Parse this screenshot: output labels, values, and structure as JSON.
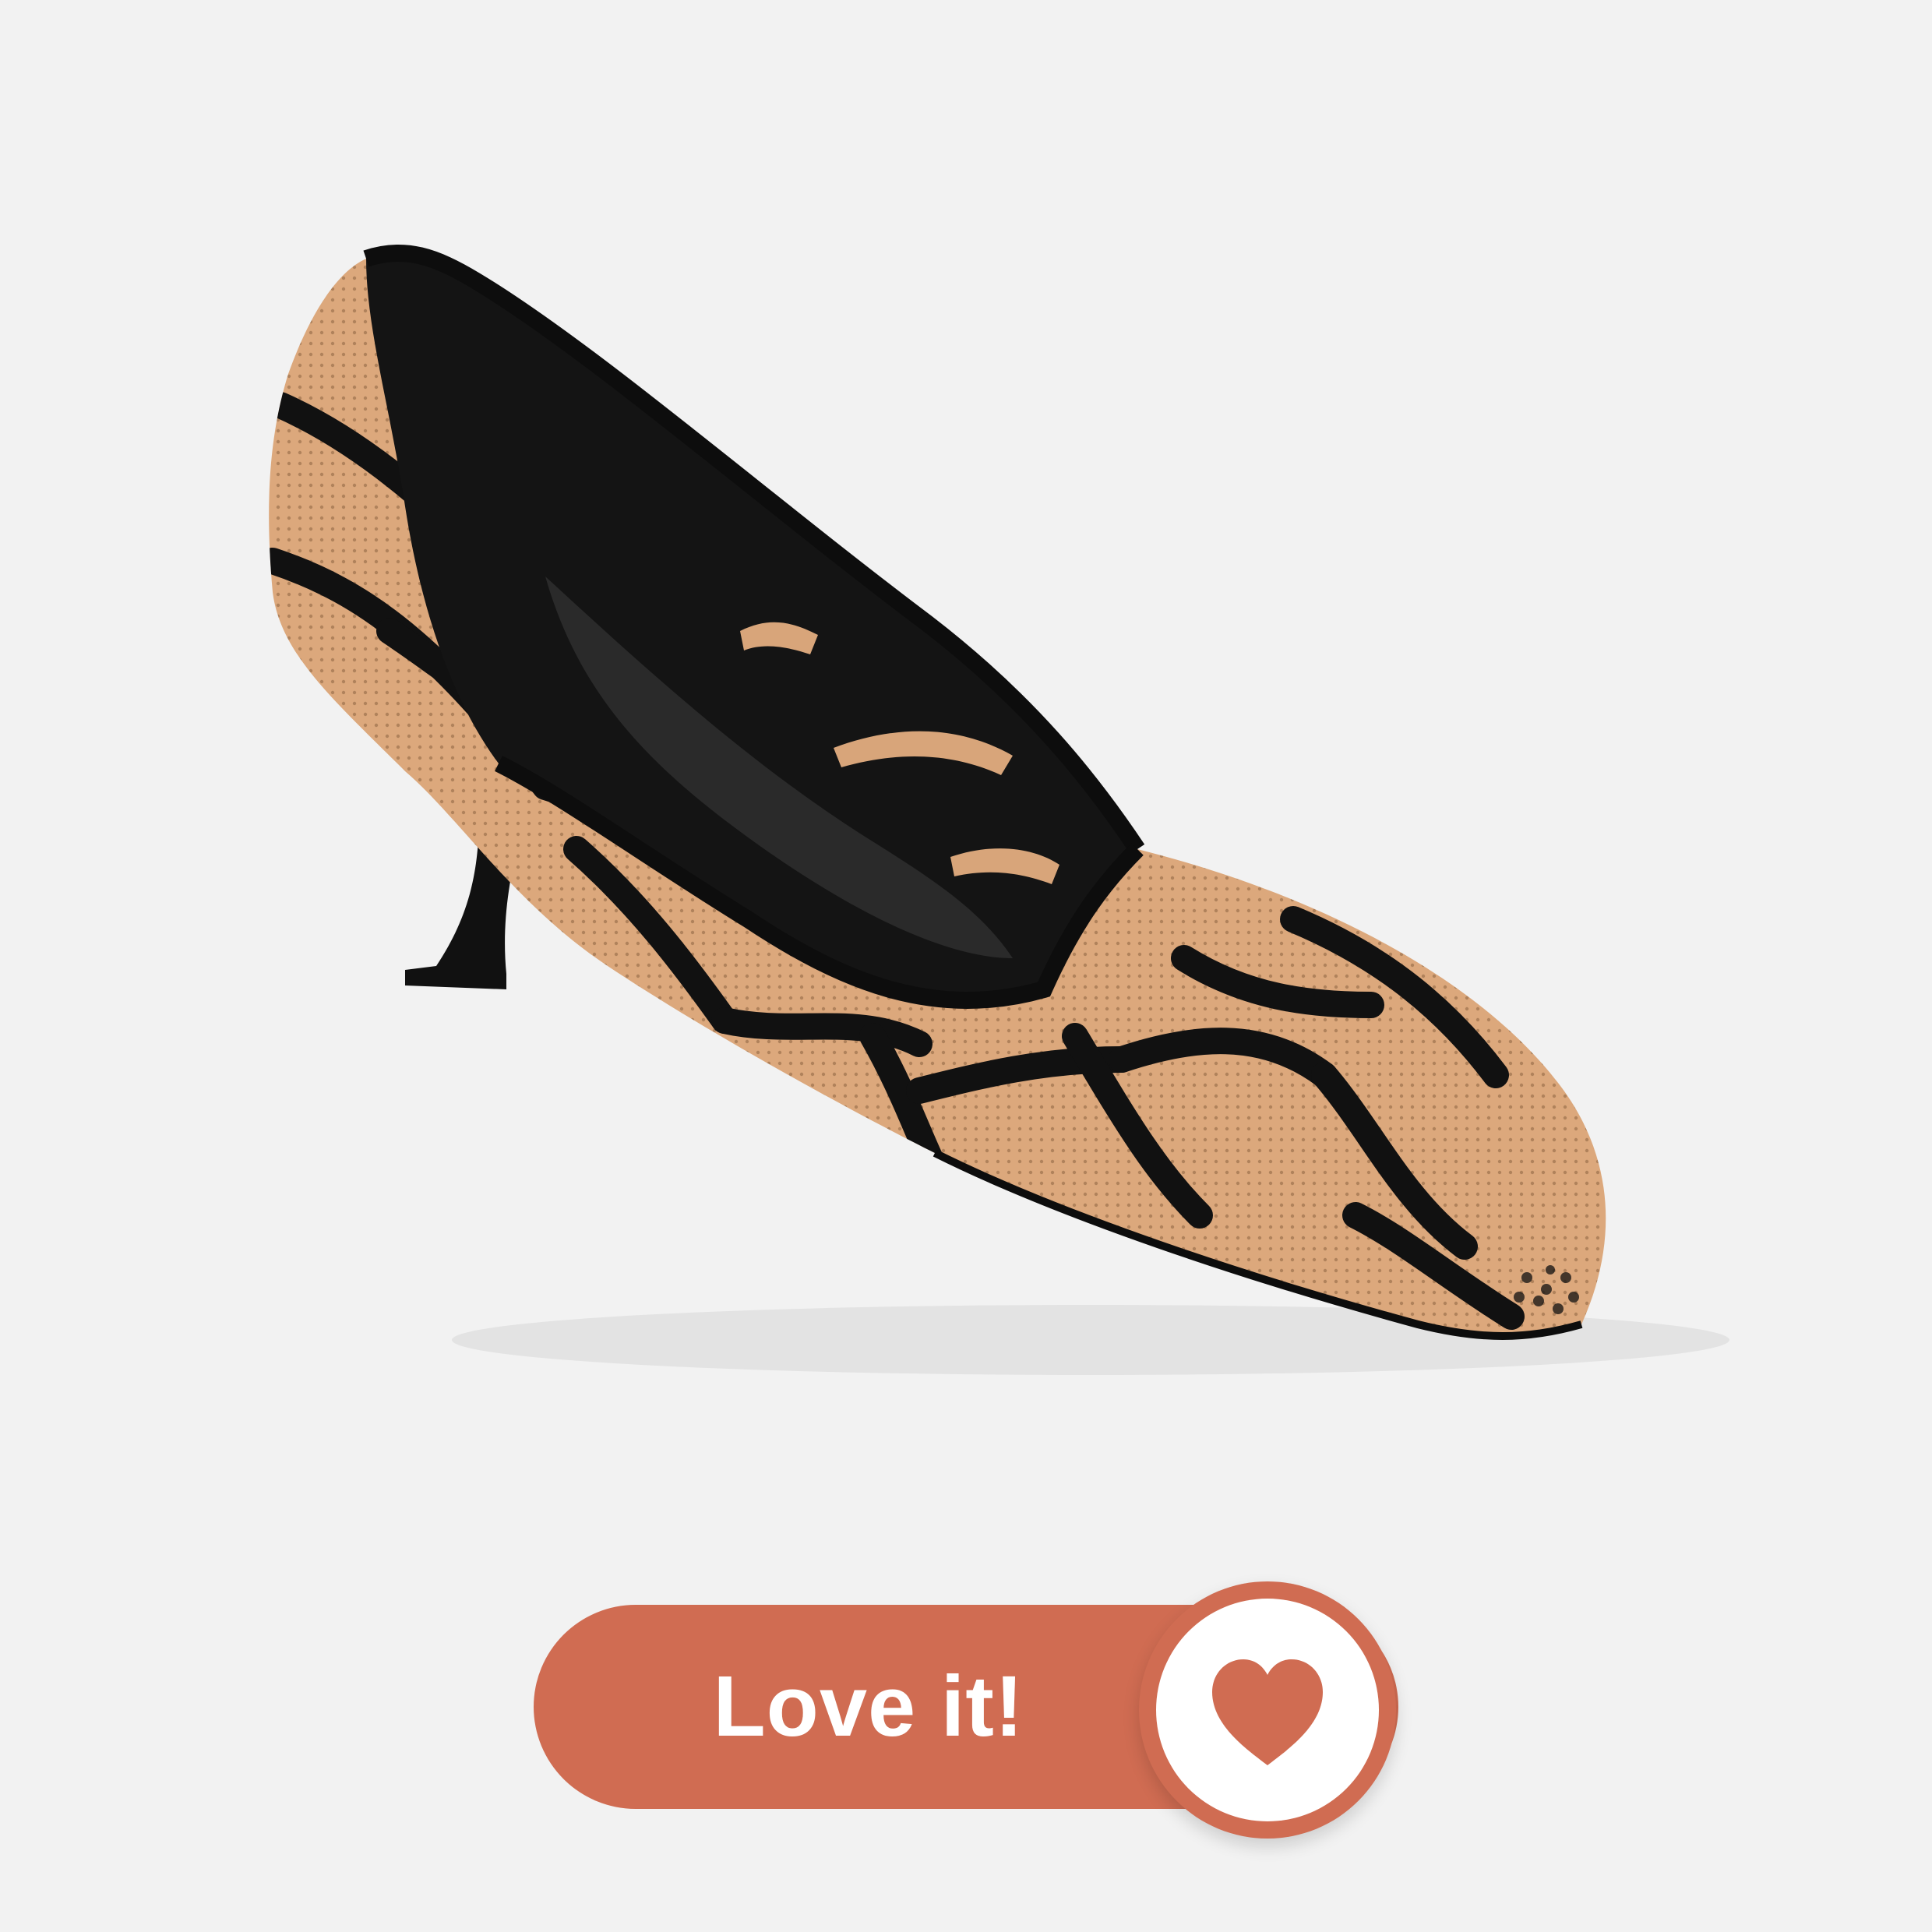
{
  "product": {
    "image_icon": "knit-pointed-toe-stiletto-pump",
    "colors": {
      "background": "#f2f2f2",
      "knit_tan": "#d9a67a",
      "pattern_black": "#111111"
    }
  },
  "cta": {
    "label": "Love it!",
    "icon": "heart-icon",
    "color": "#d06c52"
  }
}
